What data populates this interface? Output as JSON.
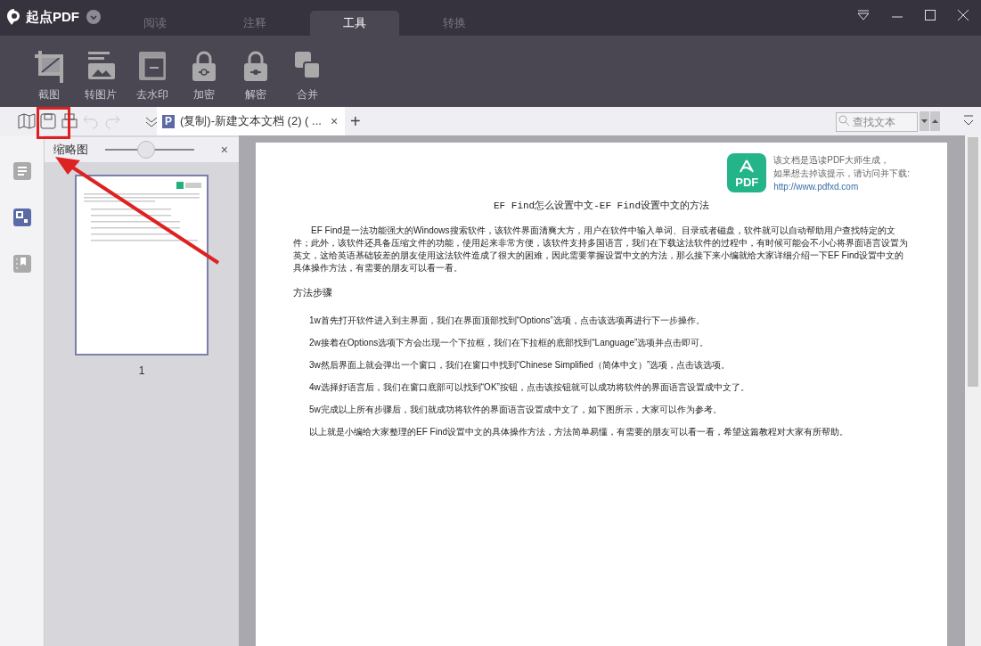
{
  "app": {
    "name": "起点PDF"
  },
  "tabs": [
    {
      "label": "阅读",
      "selected": false
    },
    {
      "label": "注释",
      "selected": false
    },
    {
      "label": "工具",
      "selected": true
    },
    {
      "label": "转换",
      "selected": false
    }
  ],
  "tools": [
    {
      "kind": "crop",
      "label": "截图"
    },
    {
      "kind": "image",
      "label": "转图片"
    },
    {
      "kind": "watermark",
      "label": "去水印"
    },
    {
      "kind": "lock",
      "label": "加密"
    },
    {
      "kind": "unlock",
      "label": "解密"
    },
    {
      "kind": "merge",
      "label": "合并"
    }
  ],
  "toolbar": [
    {
      "kind": "book",
      "disabled": false
    },
    {
      "kind": "save",
      "disabled": false
    },
    {
      "kind": "print",
      "disabled": false
    },
    {
      "kind": "undo",
      "disabled": true
    },
    {
      "kind": "redo",
      "disabled": true
    },
    {
      "kind": "more",
      "disabled": false
    }
  ],
  "doc_tab": {
    "badge": "P",
    "title": "(复制)-新建文本文档 (2) ( ...",
    "close": "×",
    "add": "+"
  },
  "search": {
    "placeholder": "查找文本"
  },
  "sidebar": [
    {
      "kind": "outline",
      "selected": false
    },
    {
      "kind": "thumbnails",
      "selected": true
    },
    {
      "kind": "bookmarks",
      "selected": false
    }
  ],
  "thumb_panel": {
    "title": "缩略图",
    "level": 0.45,
    "close": "×",
    "page_number": "1"
  },
  "document": {
    "notice": [
      "该文档是迅读PDF大师生成，",
      "如果想去掉该提示，请访问并下载:"
    ],
    "notice_link": "http://www.pdfxd.com",
    "logo_text": "PDF",
    "title": "EF Find怎么设置中文-EF Find设置中文的方法",
    "intro": "EF Find是一法功能强大的Windows搜索软件，该软件界面清爽大方，用户在软件中输入单词、目录或者磁盘，软件就可以自动帮助用户查找特定的文件；此外，该软件还具备压缩文件的功能，使用起来非常方便，该软件支持多国语言，我们在下载这法软件的过程中，有时候可能会不小心将界面语言设置为英文，这给英语基础较差的朋友使用这法软件造成了很大的困难，因此需要掌握设置中文的方法，那么接下来小编就给大家详细介绍一下EF Find设置中文的具体操作方法，有需要的朋友可以看一看。",
    "heading": "方法步骤",
    "steps": [
      "1w首先打开软件进入到主界面，我们在界面顶部找到“Options”选项，点击该选项再进行下一步操作。",
      "2w接着在Options选项下方会出现一个下拉框，我们在下拉框的底部找到“Language”选项并点击即可。",
      "3w然后界面上就会弹出一个窗口，我们在窗口中找到“Chinese Simplified（简体中文）”选项，点击该选项。",
      "4w选择好语言后，我们在窗口底部可以找到“OK”按钮，点击该按钮就可以成功将软件的界面语言设置成中文了。",
      "5w完成以上所有步骤后，我们就成功将软件的界面语言设置成中文了，如下图所示，大家可以作为参考。"
    ],
    "summary": "以上就是小编给大家整理的EF Find设置中文的具体操作方法，方法简单易懂，有需要的朋友可以看一看，希望这篇教程对大家有所帮助。"
  }
}
